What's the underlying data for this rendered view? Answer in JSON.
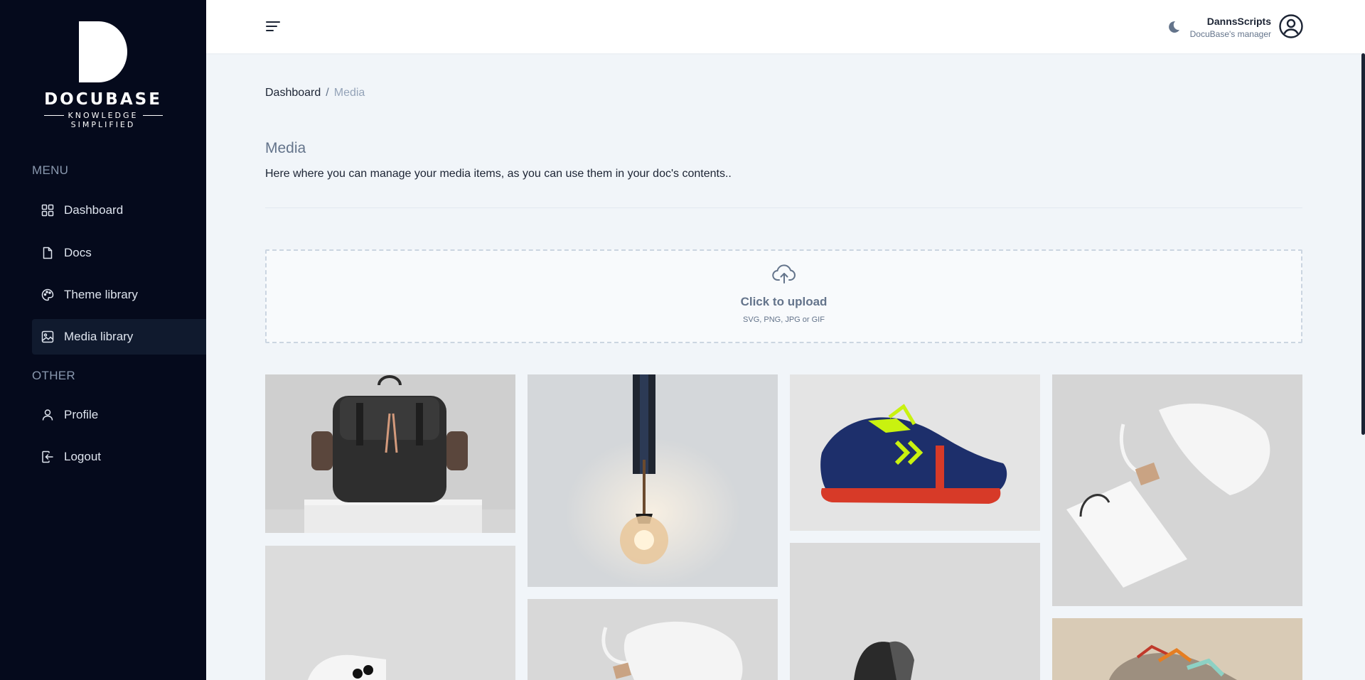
{
  "brand": {
    "name": "DOCUBASE",
    "tagline_1": "KNOWLEDGE",
    "tagline_2": "SIMPLIFIED"
  },
  "sidebar": {
    "menu_heading": "MENU",
    "other_heading": "OTHER",
    "menu_items": [
      {
        "label": "Dashboard",
        "icon": "grid-icon"
      },
      {
        "label": "Docs",
        "icon": "document-icon"
      },
      {
        "label": "Theme library",
        "icon": "palette-icon"
      },
      {
        "label": "Media library",
        "icon": "image-icon",
        "active": true
      }
    ],
    "other_items": [
      {
        "label": "Profile",
        "icon": "user-icon"
      },
      {
        "label": "Logout",
        "icon": "logout-icon"
      }
    ]
  },
  "header": {
    "user_name": "DannsScripts",
    "user_role": "DocuBase's manager"
  },
  "breadcrumb": {
    "parent": "Dashboard",
    "separator": "/",
    "current": "Media"
  },
  "page": {
    "title": "Media",
    "description": "Here where you can manage your media items, as you can use them in your doc's contents.."
  },
  "upload": {
    "title": "Click to upload",
    "formats": "SVG, PNG, JPG or GIF"
  },
  "media_items": [
    {
      "subject": "black leather backpack on white pedestal"
    },
    {
      "subject": "hanging pendant lamp with glowing bulb"
    },
    {
      "subject": "blue sneaker with yellow laces"
    },
    {
      "subject": "white drawstring pouch and shopping bag"
    },
    {
      "subject": "white game controller"
    },
    {
      "subject": "white drawstring pouch"
    },
    {
      "subject": "smartwatch"
    },
    {
      "subject": "colorful sneaker"
    }
  ],
  "colors": {
    "sidebar_bg": "#050a1c",
    "active_item_bg": "#101a2e",
    "page_bg": "#f1f5f9",
    "header_bg": "#ffffff",
    "text_primary": "#1c2434",
    "text_muted": "#64748b"
  }
}
